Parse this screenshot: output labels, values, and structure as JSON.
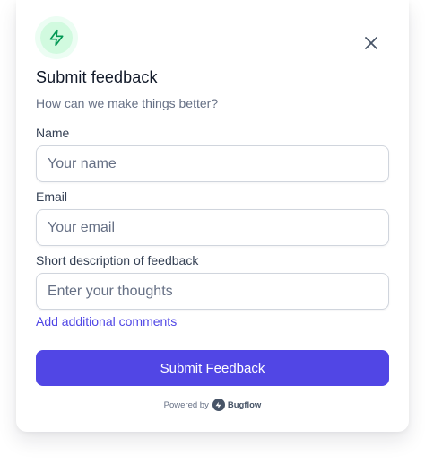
{
  "header": {
    "icon": "lightning-bolt-icon",
    "title": "Submit feedback",
    "subtitle": "How can we make things better?",
    "close_icon": "close-icon"
  },
  "form": {
    "name": {
      "label": "Name",
      "placeholder": "Your name",
      "value": ""
    },
    "email": {
      "label": "Email",
      "placeholder": "Your email",
      "value": ""
    },
    "description": {
      "label": "Short description of feedback",
      "placeholder": "Enter your thoughts",
      "value": ""
    },
    "add_comments_link": "Add additional comments",
    "submit_label": "Submit Feedback"
  },
  "footer": {
    "powered_by": "Powered by",
    "brand": "Bugflow",
    "brand_icon": "bugflow-logo-icon"
  },
  "colors": {
    "accent": "#5146e5",
    "link": "#4f46e5",
    "icon_bg": "#d1fadf",
    "icon_stroke": "#039855"
  }
}
